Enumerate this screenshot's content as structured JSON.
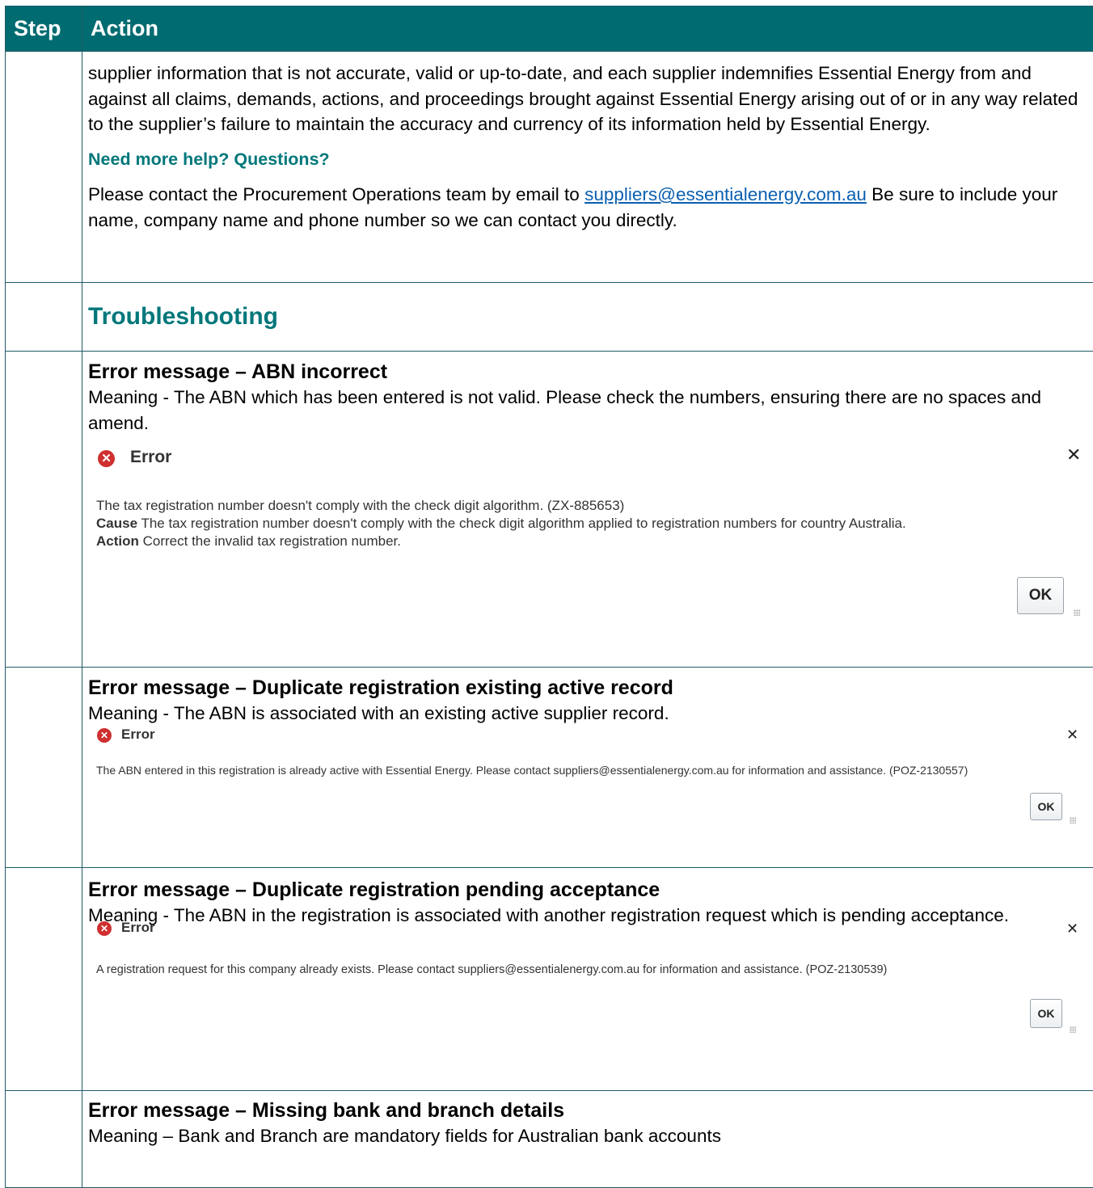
{
  "header": {
    "step": "Step",
    "action": "Action"
  },
  "row1": {
    "paragraph": "supplier information that is not accurate, valid or up-to-date, and each supplier indemnifies Essential Energy from and against all claims, demands, actions, and proceedings brought against Essential Energy arising out of or in any way related to the supplier’s failure to maintain the accuracy and currency of its information held by Essential Energy.",
    "help_heading": "Need more help? Questions?",
    "contact_before": "Please contact the Procurement Operations team by email to ",
    "contact_email": "suppliers@essentialenergy.com.au",
    "contact_after": " Be sure to include your name, company name and phone number so we can contact you directly."
  },
  "troubleshooting": "Troubleshooting",
  "errors": [
    {
      "title": "Error message – ABN incorrect",
      "meaning": "Meaning - The ABN which has been entered is not valid. Please check the numbers, ensuring there are no spaces and amend.",
      "dialog": {
        "title": "Error",
        "line1": "The tax registration number doesn't comply with the check digit algorithm. (ZX-885653)",
        "cause_label": "Cause",
        "cause_text": " The tax registration number doesn't comply with the check digit algorithm applied to registration numbers for country Australia.",
        "action_label": "Action",
        "action_text": " Correct the invalid tax registration number.",
        "ok": "OK"
      }
    },
    {
      "title": "Error message – Duplicate registration existing active record",
      "meaning": "Meaning - The ABN is associated with an existing active supplier record.",
      "dialog": {
        "title": "Error",
        "message": "The ABN entered in this registration is already active with Essential Energy. Please contact suppliers@essentialenergy.com.au for information and assistance. (POZ-2130557)",
        "ok": "OK"
      }
    },
    {
      "title": "Error message – Duplicate registration pending acceptance",
      "meaning": "Meaning - The ABN in the registration is associated with another registration request which is pending acceptance.",
      "dialog": {
        "title": "Error",
        "message": "A registration request for this company already exists. Please contact suppliers@essentialenergy.com.au for information and assistance. (POZ-2130539)",
        "ok": "OK"
      }
    },
    {
      "title": "Error message – Missing bank and branch details",
      "meaning": "Meaning – Bank and Branch are mandatory fields for Australian bank accounts"
    }
  ],
  "colors": {
    "header_bg": "#006b70",
    "accent": "#00777a",
    "link": "#0b5fb0",
    "error_icon": "#cf2f2f"
  }
}
